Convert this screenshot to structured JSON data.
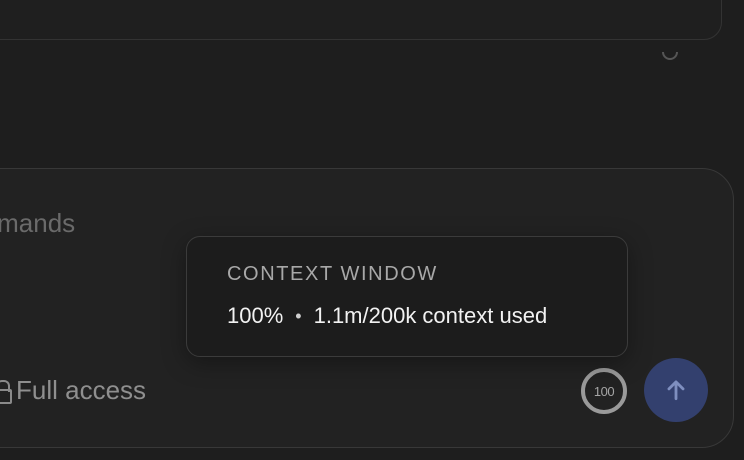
{
  "composer": {
    "placeholder_fragment": "commands",
    "access_label": "Full access",
    "context_ring_value": "100"
  },
  "tooltip": {
    "title": "CONTEXT WINDOW",
    "percent": "100%",
    "separator": "•",
    "detail": "1.1m/200k context used"
  },
  "icons": {
    "access": "lock-icon",
    "send": "arrow-up-icon",
    "ring": "context-ring-icon"
  },
  "colors": {
    "background": "#1e1e1e",
    "send_button": "#33406e",
    "ring": "#9a9a9a"
  }
}
